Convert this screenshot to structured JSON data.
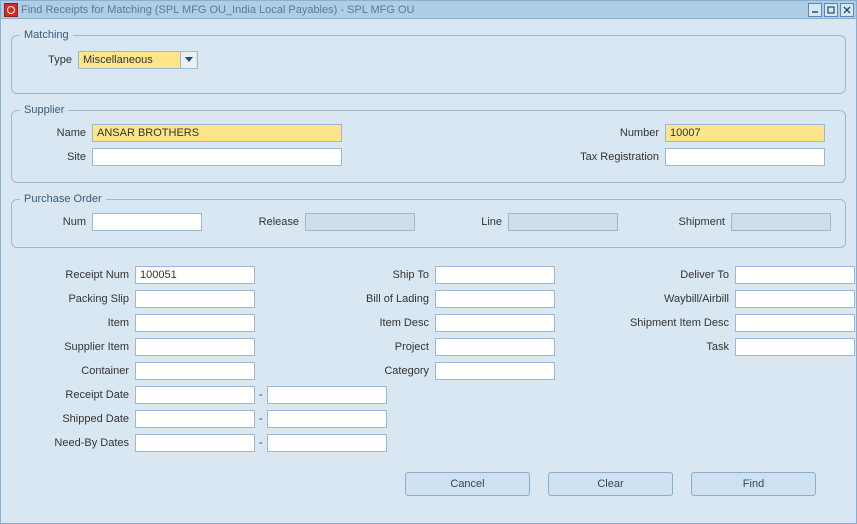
{
  "window": {
    "title": "Find Receipts for Matching (SPL MFG OU_India Local Payables) - SPL MFG OU"
  },
  "matching": {
    "legend": "Matching",
    "type_label": "Type",
    "type_value": "Miscellaneous"
  },
  "supplier": {
    "legend": "Supplier",
    "name_label": "Name",
    "name_value": "ANSAR BROTHERS",
    "site_label": "Site",
    "site_value": "",
    "number_label": "Number",
    "number_value": "10007",
    "tax_label": "Tax Registration",
    "tax_value": ""
  },
  "po": {
    "legend": "Purchase Order",
    "num_label": "Num",
    "num_value": "",
    "release_label": "Release",
    "release_value": "",
    "line_label": "Line",
    "line_value": "",
    "shipment_label": "Shipment",
    "shipment_value": ""
  },
  "details": {
    "receipt_num_label": "Receipt Num",
    "receipt_num_value": "100051",
    "packing_slip_label": "Packing Slip",
    "packing_slip_value": "",
    "item_label": "Item",
    "item_value": "",
    "supplier_item_label": "Supplier Item",
    "supplier_item_value": "",
    "container_label": "Container",
    "container_value": "",
    "receipt_date_label": "Receipt Date",
    "receipt_date_from": "",
    "receipt_date_to": "",
    "shipped_date_label": "Shipped Date",
    "shipped_date_from": "",
    "shipped_date_to": "",
    "needby_date_label": "Need-By Dates",
    "needby_date_from": "",
    "needby_date_to": "",
    "ship_to_label": "Ship To",
    "ship_to_value": "",
    "bol_label": "Bill of Lading",
    "bol_value": "",
    "item_desc_label": "Item Desc",
    "item_desc_value": "",
    "project_label": "Project",
    "project_value": "",
    "category_label": "Category",
    "category_value": "",
    "deliver_to_label": "Deliver To",
    "deliver_to_value": "",
    "waybill_label": "Waybill/Airbill",
    "waybill_value": "",
    "ship_item_desc_label": "Shipment Item Desc",
    "ship_item_desc_value": "",
    "task_label": "Task",
    "task_value": ""
  },
  "buttons": {
    "cancel": "Cancel",
    "clear": "Clear",
    "find": "Find"
  },
  "dash": "-"
}
